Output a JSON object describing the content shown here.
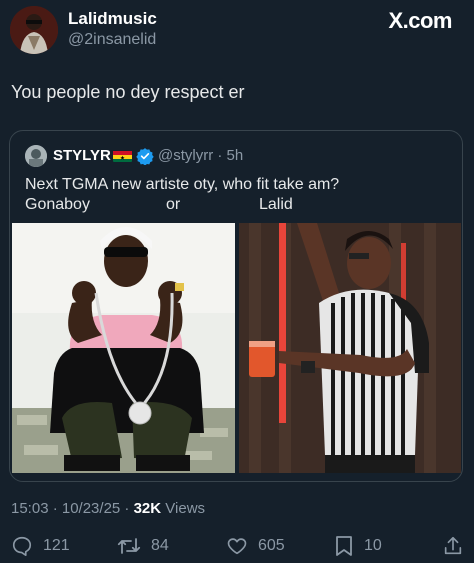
{
  "author": {
    "name": "Lalidmusic",
    "handle": "@2insanelid"
  },
  "brand": "X.com",
  "tweet": {
    "text": "You people no dey respect er"
  },
  "quoted": {
    "name": "STYLYR",
    "handle_time": "@stylyrr · 5h",
    "line1": "Next TGMA new artiste oty, who fit take am?",
    "options": [
      "Gonaboy",
      "or",
      "Lalid"
    ]
  },
  "meta": {
    "time_date": "15:03 · 10/23/25 · ",
    "views_count": "32K",
    "views_label": " Views"
  },
  "actions": {
    "replies": "121",
    "reposts": "84",
    "likes": "605",
    "bookmarks": "10"
  },
  "colors": {
    "background": "#15202b",
    "muted": "#8b98a5",
    "verified": "#1d9bf0",
    "border": "#38444d"
  },
  "icons": [
    "reply-icon",
    "repost-icon",
    "like-icon",
    "bookmark-icon",
    "share-icon",
    "verified-icon",
    "ghana-flag-icon"
  ]
}
